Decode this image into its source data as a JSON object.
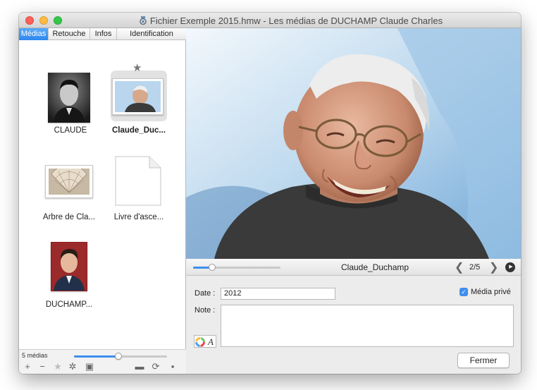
{
  "window": {
    "title": "Fichier Exemple 2015.hmw - Les médias de DUCHAMP Claude Charles"
  },
  "tabs": [
    {
      "label": "Médias"
    },
    {
      "label": "Retouche"
    },
    {
      "label": "Infos"
    },
    {
      "label": "Identification"
    }
  ],
  "media": [
    {
      "label": "CLAUDE",
      "selected": false,
      "icon": "portrait-bw-photo"
    },
    {
      "label": "Claude_Duc...",
      "selected": true,
      "icon": "portrait-color-photo",
      "favorite": true
    },
    {
      "label": "Arbre de Cla...",
      "selected": false,
      "icon": "family-tree-image"
    },
    {
      "label": "Livre d'asce...",
      "selected": false,
      "icon": "blank-document-icon"
    },
    {
      "label": "DUCHAMP...",
      "selected": false,
      "icon": "portrait-young-photo"
    }
  ],
  "left_footer": {
    "count": "5 médias",
    "thumb_zoom": 0.48,
    "tools": [
      "add-icon",
      "remove-icon",
      "star-icon",
      "gear-icon",
      "gallery-icon",
      "folder-icon",
      "refresh-icon",
      "save-icon"
    ],
    "tool_glyphs": [
      "+",
      "−",
      "★",
      "✲",
      "▣",
      "▬",
      "⟳",
      "▪"
    ]
  },
  "viewer": {
    "media_name": "Claude_Duchamp",
    "zoom": 0.22,
    "page": "2/5",
    "prev_glyph": "❮",
    "next_glyph": "❯",
    "play_glyph": "▶"
  },
  "form": {
    "date_label": "Date :",
    "date_value": "2012",
    "private_label": "Média privé",
    "private_checked": true,
    "check_glyph": "✓",
    "note_label": "Note :",
    "note_value": "",
    "close_label": "Fermer"
  },
  "colors": {
    "accent": "#3d8fef"
  }
}
